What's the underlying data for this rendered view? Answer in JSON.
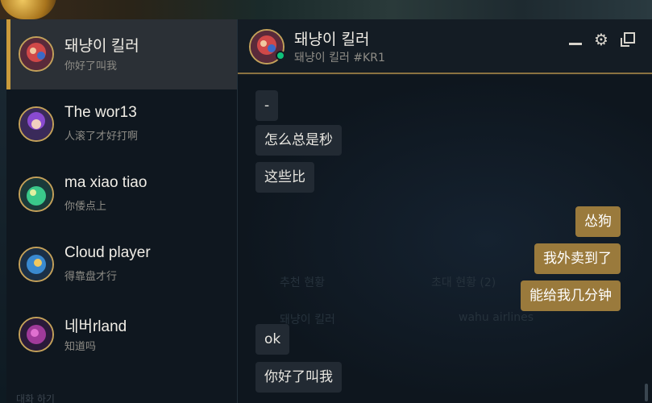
{
  "friends": [
    {
      "name": "돼냥이 킬러",
      "status": "你好了叫我",
      "active": true
    },
    {
      "name": "The wor13",
      "status": "人滚了才好打啊",
      "active": false
    },
    {
      "name": "ma xiao tiao",
      "status": "你倭点上",
      "active": false
    },
    {
      "name": "Cloud player",
      "status": "得靠盘才行",
      "active": false
    },
    {
      "name": "네버rland",
      "status": "知道吗",
      "active": false
    }
  ],
  "friend_list_footer": "대화 하기",
  "chat": {
    "title": "돼냥이 킬러",
    "subtitle": "돼냥이 킬러 #KR1",
    "ghost_text": {
      "col1_header": "추천 현황",
      "col2_header": "초대 현황 (2)",
      "col1_row": "돼냥이 킬러",
      "col2_row": "wahu airlines"
    },
    "messages": [
      {
        "text": "-",
        "dir": "in"
      },
      {
        "text": "怎么总是秒",
        "dir": "in"
      },
      {
        "text": "这些比",
        "dir": "in"
      },
      {
        "text": "怂狗",
        "dir": "out"
      },
      {
        "text": "我外卖到了",
        "dir": "out"
      },
      {
        "text": "能给我几分钟",
        "dir": "out"
      },
      {
        "text": "ok",
        "dir": "in"
      },
      {
        "text": "你好了叫我",
        "dir": "in"
      }
    ]
  },
  "colors": {
    "accent_gold": "#c89b3c",
    "outgoing_bubble": "#9a7a3c",
    "incoming_bubble": "#222a33",
    "online": "#0ec27a"
  },
  "icons": {
    "minimize": "minimize-icon",
    "settings": "gear-icon",
    "popout": "popout-icon"
  }
}
